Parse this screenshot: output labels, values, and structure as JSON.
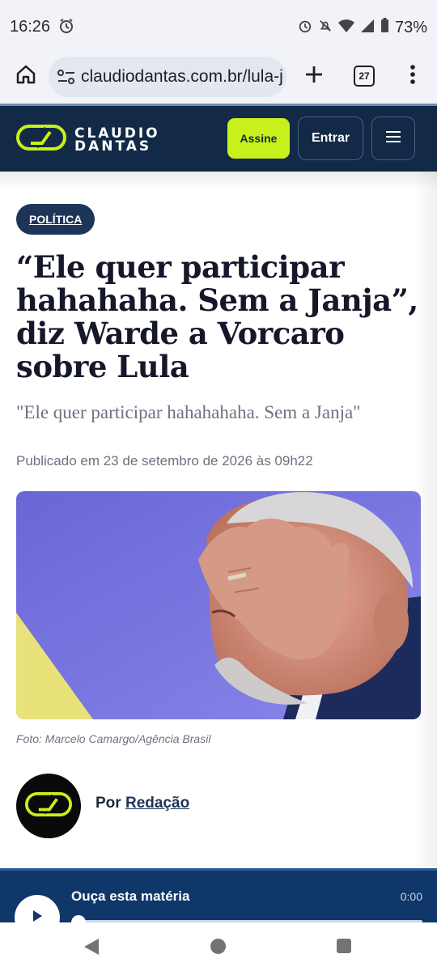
{
  "status_bar": {
    "time": "16:26",
    "battery": "73%",
    "icons": [
      "alarm-icon",
      "alarm-icon",
      "mute-icon",
      "wifi-icon",
      "signal-icon",
      "battery-icon"
    ]
  },
  "browser": {
    "url": "claudiodantas.com.br/lula-janja",
    "tab_count": "27",
    "icons": [
      "home-icon",
      "site-settings-icon",
      "plus-icon",
      "more-vert-icon"
    ]
  },
  "site_header": {
    "logo_line1": "CLAUDIO",
    "logo_line2": "DANTAS",
    "subscribe_label": "Assine",
    "login_label": "Entrar",
    "brand_color": "#122a47",
    "accent_color": "#c8f01a"
  },
  "article": {
    "category": "POLÍTICA",
    "headline": "“Ele quer participar hahahaha. Sem a Janja”, diz Warde a Vorcaro sobre Lula",
    "subheadline": "\"Ele quer participar hahahahaha. Sem a Janja\"",
    "published": "Publicado em 23 de setembro de 2026 às 09h22",
    "photo_caption": "Foto: Marcelo Camargo/Agência Brasil",
    "author_prefix": "Por",
    "author_name": "Redação"
  },
  "audio_player": {
    "title": "Ouça esta matéria",
    "time": "0:00",
    "progress": 0
  }
}
